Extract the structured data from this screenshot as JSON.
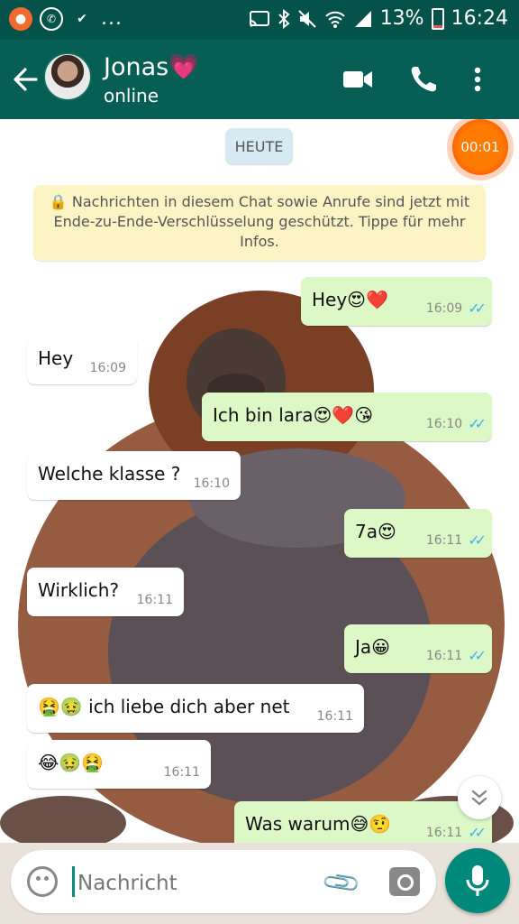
{
  "status_bar": {
    "left_icons": [
      "screen-recorder-icon",
      "whatsapp-icon",
      "checkmark-flag-icon"
    ],
    "overflow": "...",
    "right_icons": [
      "cast-icon",
      "bluetooth-icon",
      "mute-icon",
      "wifi-icon",
      "signal-icon"
    ],
    "battery": "13%",
    "battery_level": 0.13,
    "time": "16:24"
  },
  "header": {
    "contact_name": "Jonas💗",
    "status": "online",
    "actions": [
      "video-call-icon",
      "voice-call-icon",
      "more-options-icon"
    ]
  },
  "chat": {
    "date_label": "HEUTE",
    "recording_timer": "00:01",
    "encryption_notice": "🔒 Nachrichten in diesem Chat sowie Anrufe sind jetzt mit Ende-zu-Ende-Verschlüsselung geschützt. Tippe für mehr Infos.",
    "messages": [
      {
        "direction": "out",
        "text": "Hey😍❤️",
        "time": "16:09",
        "read": true
      },
      {
        "direction": "in",
        "text": "Hey",
        "time": "16:09"
      },
      {
        "direction": "out",
        "text": "Ich bin lara😍❤️😘",
        "time": "16:10",
        "read": true
      },
      {
        "direction": "in",
        "text": "Welche klasse ?",
        "time": "16:10"
      },
      {
        "direction": "out",
        "text": "7a😍",
        "time": "16:11",
        "read": true
      },
      {
        "direction": "in",
        "text": "Wirklich?",
        "time": "16:11"
      },
      {
        "direction": "out",
        "text": "Ja😀",
        "time": "16:11",
        "read": true
      },
      {
        "direction": "in",
        "text": "🤮🤢 ich liebe dich aber net",
        "time": "16:11"
      },
      {
        "direction": "in",
        "text": "😂🤢🤮",
        "time": "16:11"
      },
      {
        "direction": "out",
        "text": "Was warum😅🤨",
        "time": "16:11",
        "read": true
      }
    ],
    "read_ticks": "✓✓",
    "scroll_down_icon": "chevron-double-down-icon"
  },
  "composer": {
    "placeholder": "Nachricht",
    "icons": [
      "emoji-icon",
      "attach-icon",
      "camera-icon",
      "mic-icon"
    ]
  },
  "colors": {
    "header": "#075e54",
    "status_bar": "#05524a",
    "outgoing_bubble": "#dcf8c6",
    "incoming_bubble": "#ffffff",
    "read_ticks": "#34b7f1",
    "mic_button": "#00897b"
  }
}
